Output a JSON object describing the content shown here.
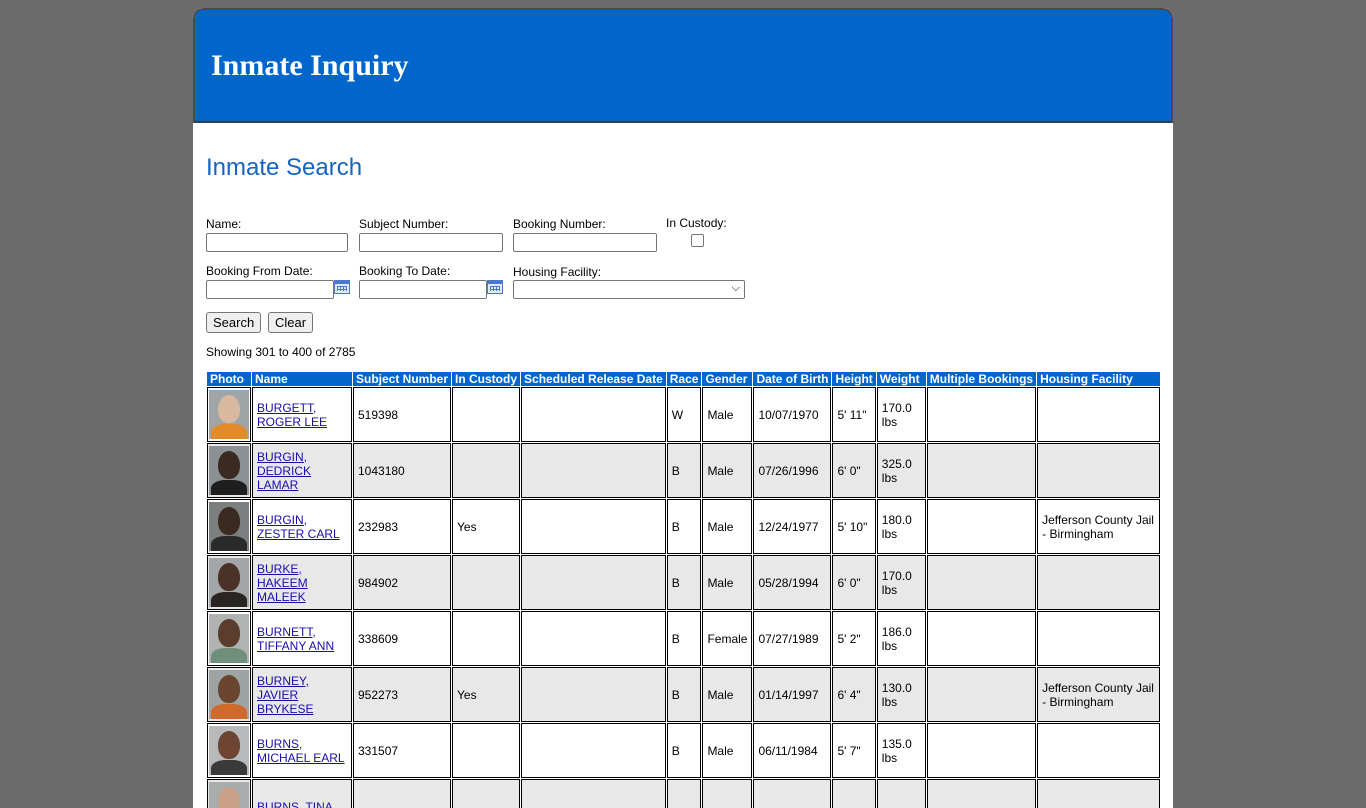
{
  "header": {
    "title": "Inmate Inquiry"
  },
  "search": {
    "title": "Inmate Search",
    "name_label": "Name:",
    "subject_label": "Subject Number:",
    "booking_label": "Booking Number:",
    "custody_label": "In Custody:",
    "from_label": "Booking From Date:",
    "to_label": "Booking To Date:",
    "housing_label": "Housing Facility:",
    "search_button": "Search",
    "clear_button": "Clear"
  },
  "results": {
    "showing": "Showing 301 to 400 of 2785",
    "columns": [
      "Photo",
      "Name",
      "Subject Number",
      "In Custody",
      "Scheduled Release Date",
      "Race",
      "Gender",
      "Date of Birth",
      "Height",
      "Weight",
      "Multiple Bookings",
      "Housing Facility"
    ],
    "rows": [
      {
        "name": "BURGETT, ROGER LEE",
        "subject": "519398",
        "custody": "",
        "release": "",
        "race": "W",
        "gender": "Male",
        "dob": "10/07/1970",
        "height": "5' 11\"",
        "weight": "170.0 lbs",
        "multiple": "",
        "housing": "",
        "skin": "#d9b8a0",
        "shirt": "#e48a2a",
        "bg": "#9fa4a6"
      },
      {
        "name": "BURGIN, DEDRICK LAMAR",
        "subject": "1043180",
        "custody": "",
        "release": "",
        "race": "B",
        "gender": "Male",
        "dob": "07/26/1996",
        "height": "6' 0\"",
        "weight": "325.0 lbs",
        "multiple": "",
        "housing": "",
        "skin": "#3b2a22",
        "shirt": "#1e1e1e",
        "bg": "#8c9196"
      },
      {
        "name": "BURGIN, ZESTER CARL",
        "subject": "232983",
        "custody": "Yes",
        "release": "",
        "race": "B",
        "gender": "Male",
        "dob": "12/24/1977",
        "height": "5' 10\"",
        "weight": "180.0 lbs",
        "multiple": "",
        "housing": "Jefferson County Jail - Birmingham",
        "skin": "#3a2a20",
        "shirt": "#2a2a2a",
        "bg": "#7b7f80"
      },
      {
        "name": "BURKE, HAKEEM MALEEK",
        "subject": "984902",
        "custody": "",
        "release": "",
        "race": "B",
        "gender": "Male",
        "dob": "05/28/1994",
        "height": "6' 0\"",
        "weight": "170.0 lbs",
        "multiple": "",
        "housing": "",
        "skin": "#4a3226",
        "shirt": "#2a2522",
        "bg": "#a3a6a8"
      },
      {
        "name": "BURNETT, TIFFANY ANN",
        "subject": "338609",
        "custody": "",
        "release": "",
        "race": "B",
        "gender": "Female",
        "dob": "07/27/1989",
        "height": "5' 2\"",
        "weight": "186.0 lbs",
        "multiple": "",
        "housing": "",
        "skin": "#5a3d2d",
        "shirt": "#6f8f7a",
        "bg": "#b0b3b2"
      },
      {
        "name": "BURNEY, JAVIER BRYKESE",
        "subject": "952273",
        "custody": "Yes",
        "release": "",
        "race": "B",
        "gender": "Male",
        "dob": "01/14/1997",
        "height": "6' 4\"",
        "weight": "130.0 lbs",
        "multiple": "",
        "housing": "Jefferson County Jail - Birmingham",
        "skin": "#6a4530",
        "shirt": "#d06a2a",
        "bg": "#9ea3a4"
      },
      {
        "name": "BURNS, MICHAEL EARL",
        "subject": "331507",
        "custody": "",
        "release": "",
        "race": "B",
        "gender": "Male",
        "dob": "06/11/1984",
        "height": "5' 7\"",
        "weight": "135.0 lbs",
        "multiple": "",
        "housing": "",
        "skin": "#6d4532",
        "shirt": "#3a3a3a",
        "bg": "#b7b9ba"
      },
      {
        "name": "BURNS, TINA",
        "subject": "",
        "custody": "",
        "release": "",
        "race": "",
        "gender": "",
        "dob": "",
        "height": "",
        "weight": "",
        "multiple": "",
        "housing": "",
        "skin": "#c9a088",
        "shirt": "#8a8a8a",
        "bg": "#a9acad"
      }
    ]
  }
}
